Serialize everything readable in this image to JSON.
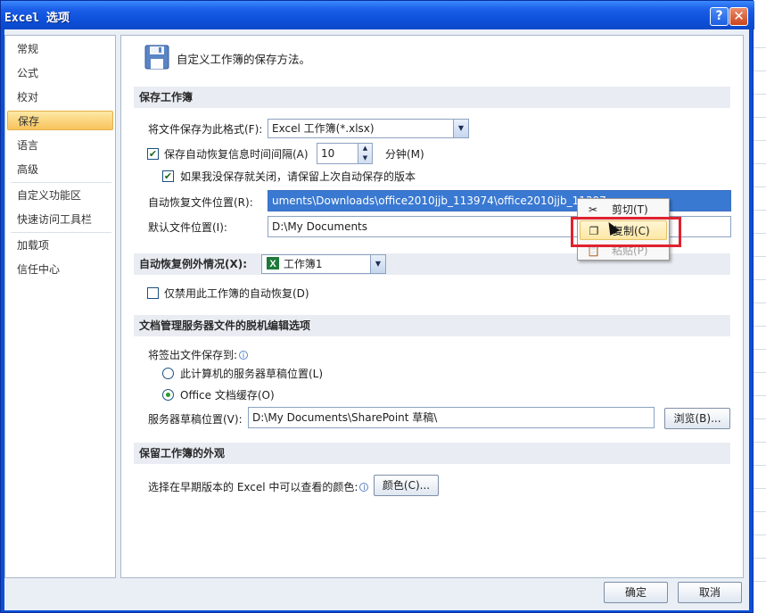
{
  "window": {
    "title": "Excel 选项",
    "help_glyph": "?",
    "close_glyph": "✕"
  },
  "sidebar": {
    "items": [
      {
        "label": "常规"
      },
      {
        "label": "公式"
      },
      {
        "label": "校对"
      },
      {
        "label": "保存",
        "active": true
      },
      {
        "label": "语言"
      },
      {
        "label": "高级"
      },
      {
        "label": "自定义功能区"
      },
      {
        "label": "快速访问工具栏"
      },
      {
        "label": "加载项"
      },
      {
        "label": "信任中心"
      }
    ]
  },
  "main": {
    "header_desc": "自定义工作簿的保存方法。",
    "sections": {
      "save_workbooks": "保存工作簿",
      "autorecover_exceptions": "自动恢复例外情况(X):",
      "offline_editing": "文档管理服务器文件的脱机编辑选项",
      "preserve_visual": "保留工作簿的外观"
    },
    "save_format_label": "将文件保存为此格式(F):",
    "save_format_value": "Excel 工作簿(*.xlsx)",
    "autorecover_interval_label": "保存自动恢复信息时间间隔(A)",
    "autorecover_interval_value": "10",
    "autorecover_interval_unit": "分钟(M)",
    "keep_last_autosaved_label": "如果我没保存就关闭，请保留上次自动保存的版本",
    "autorecover_location_label": "自动恢复文件位置(R):",
    "autorecover_location_value": "uments\\Downloads\\office2010jjb_113974\\office2010jjb_11397 4\\office2010\\AutoRecover\\",
    "default_location_label": "默认文件位置(I):",
    "default_location_value": "D:\\My Documents",
    "exceptions_workbook_value": "工作簿1",
    "disable_autorecover_label": "仅禁用此工作簿的自动恢复(D)",
    "checked_out_label": "将签出文件保存到:",
    "radio_server_drafts": "此计算机的服务器草稿位置(L)",
    "radio_office_cache": "Office 文档缓存(O)",
    "server_drafts_label": "服务器草稿位置(V):",
    "server_drafts_value": "D:\\My Documents\\SharePoint 草稿\\",
    "browse_button": "浏览(B)...",
    "colors_label": "选择在早期版本的 Excel 中可以查看的颜色:",
    "colors_button": "颜色(C)..."
  },
  "context_menu": {
    "items": [
      {
        "label": "剪切(T)",
        "icon": "scissors-icon"
      },
      {
        "label": "复制(C)",
        "icon": "copy-icon",
        "hover": true
      },
      {
        "label": "粘贴(P)",
        "icon": "paste-icon",
        "disabled": true
      }
    ]
  },
  "footer": {
    "ok_button": "确定",
    "cancel_button": "取消"
  },
  "colors": {
    "title_bar": "#0c4fd8",
    "highlight": "#3a79d2",
    "active_nav": "#f8c35b",
    "annotation_box": "#e0222f"
  }
}
